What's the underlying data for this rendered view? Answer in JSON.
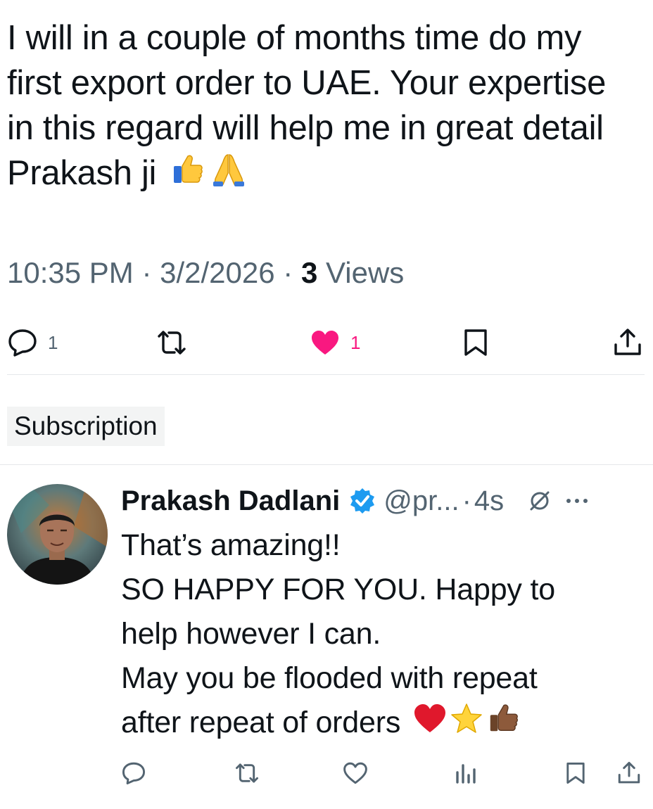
{
  "tweet": {
    "lines": [
      "I will in a couple of months time do my",
      "first export order to UAE. Your expertise",
      "in this regard will help me in great detail",
      "Prakash ji"
    ],
    "emojis": [
      "thumbs-up-emoji",
      "folded-hands-emoji"
    ],
    "time": "10:35 PM",
    "date": "3/2/2026",
    "views_count": "3",
    "views_label": "Views",
    "actions": {
      "reply_count": "1",
      "repost_count": "",
      "like_count": "1",
      "liked": true
    }
  },
  "subscription_label": "Subscription",
  "reply": {
    "author_name": "Prakash Dadlani",
    "verified": true,
    "handle": "@pr...",
    "time": "4s",
    "lines": [
      "That’s amazing!!",
      "SO HAPPY FOR YOU. Happy to",
      "help however I can.",
      "May you be flooded with repeat",
      "after repeat of orders"
    ],
    "emojis": [
      "red-heart-emoji",
      "star-emoji",
      "thumbs-up-dark-emoji"
    ]
  },
  "colors": {
    "text": "#0f1419",
    "muted": "#536471",
    "like": "#f91880",
    "verified": "#1d9bf0",
    "divider": "#e5e7ea"
  }
}
